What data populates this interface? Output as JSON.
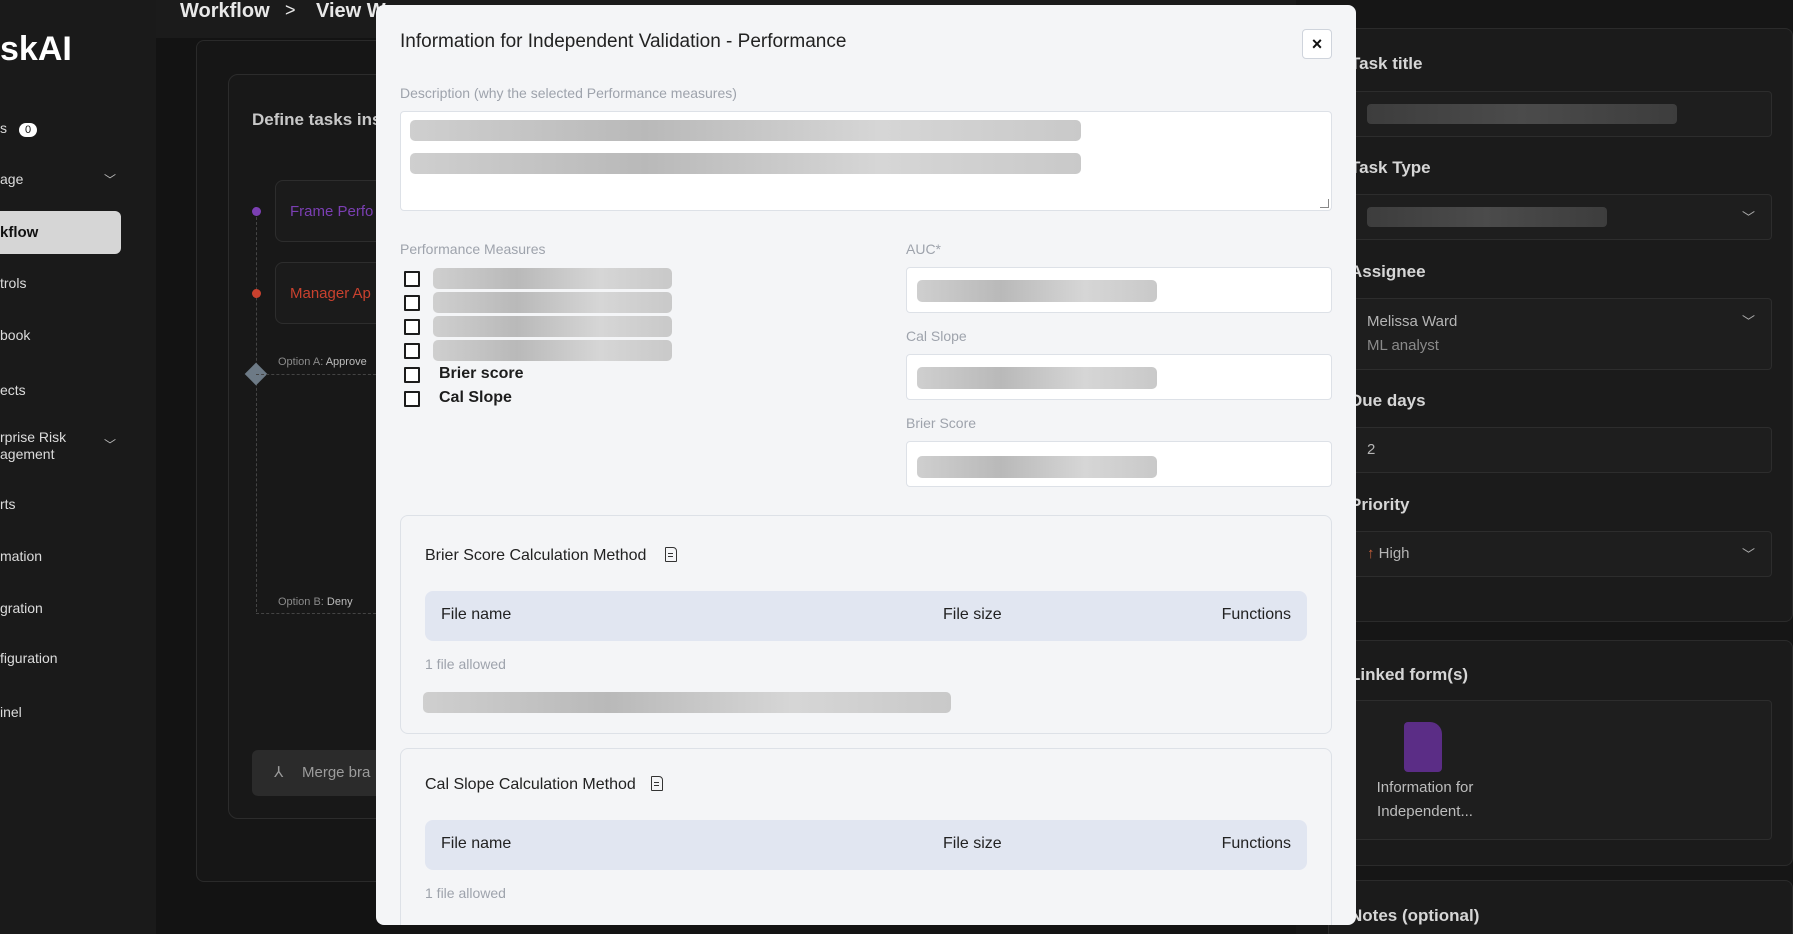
{
  "background": {
    "brand_name": "skAI",
    "sidebar": {
      "badge_item_label": "s",
      "badge_count": "0",
      "items": [
        {
          "label": "age",
          "has_chevron": true
        },
        {
          "label": "kflow",
          "active": true
        },
        {
          "label": "trols"
        },
        {
          "label": "book"
        },
        {
          "label": "ects"
        },
        {
          "label": "rprise Risk agement",
          "has_chevron": true
        },
        {
          "label": "rts"
        },
        {
          "label": "mation"
        },
        {
          "label": "gration"
        },
        {
          "label": "figuration"
        },
        {
          "label": "inel"
        }
      ]
    },
    "breadcrumb": {
      "first": "Workflow",
      "separator": ">",
      "second": "View W"
    },
    "workflow": {
      "title": "Define tasks ins",
      "nodes": [
        "Frame Perfo",
        "Manager Ap"
      ],
      "option_a_prefix": "Option A:",
      "option_a_value": "Approve",
      "option_b_prefix": "Option B:",
      "option_b_value": "Deny",
      "merge_label": "Merge bra"
    },
    "right_panel": {
      "task_title_label": "Task title",
      "task_type_label": "Task Type",
      "assignee_label": "Assignee",
      "assignee_name": "Melissa Ward",
      "assignee_role": "ML analyst",
      "due_days_label": "Due days",
      "due_days_value": "2",
      "priority_label": "Priority",
      "priority_icon": "↑",
      "priority_value": "High",
      "linked_forms_label": "Linked form(s)",
      "linked_form_name_1": "Information for",
      "linked_form_name_2": "Independent...",
      "notes_label": "Notes (optional)"
    }
  },
  "modal": {
    "title": "Information for Independent Validation - Performance",
    "close_icon": "×",
    "description_label": "Description (why the selected Performance measures)",
    "performance_measures_label": "Performance Measures",
    "measures": [
      {
        "label": "",
        "skeleton": true
      },
      {
        "label": "",
        "skeleton": true
      },
      {
        "label": "",
        "skeleton": true
      },
      {
        "label": "",
        "skeleton": true
      },
      {
        "label": "Brier score"
      },
      {
        "label": "Cal Slope"
      }
    ],
    "auc_label": "AUC*",
    "cal_slope_label": "Cal Slope",
    "brier_score_label": "Brier Score",
    "sections": [
      {
        "title": "Brier Score Calculation Method",
        "col_file_name": "File name",
        "col_file_size": "File size",
        "col_functions": "Functions",
        "allowed": "1 file allowed"
      },
      {
        "title": "Cal Slope Calculation Method",
        "col_file_name": "File name",
        "col_file_size": "File size",
        "col_functions": "Functions",
        "allowed": "1 file allowed"
      }
    ]
  }
}
